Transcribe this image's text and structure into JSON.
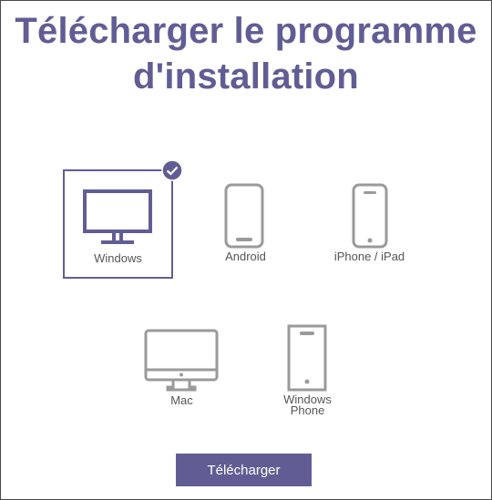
{
  "title": {
    "line1": "Télécharger le programme",
    "line2": "d'installation"
  },
  "options": [
    {
      "label": "Windows",
      "icon": "monitor-icon",
      "selected": true
    },
    {
      "label": "Android",
      "icon": "android-phone-icon",
      "selected": false
    },
    {
      "label": "iPhone / iPad",
      "icon": "iphone-icon",
      "selected": false
    },
    {
      "label": "Mac",
      "icon": "imac-icon",
      "selected": false
    },
    {
      "label_line1": "Windows",
      "label_line2": "Phone",
      "icon": "windows-phone-icon",
      "selected": false
    }
  ],
  "download_button": {
    "label": "Télécharger"
  },
  "colors": {
    "accent": "#615d94",
    "icon_gray": "#9a9a9a",
    "text_gray": "#555555",
    "check_fill": "#615d94"
  }
}
